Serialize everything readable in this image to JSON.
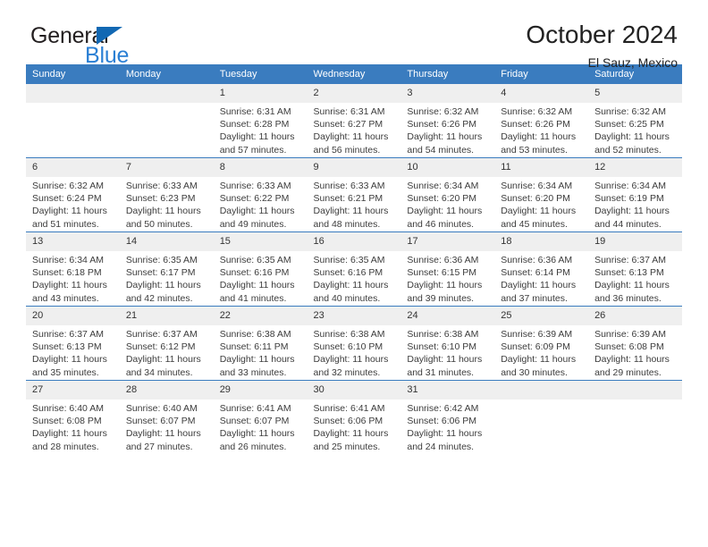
{
  "brand": {
    "name_top": "General",
    "name_bottom": "Blue",
    "triangle_color": "#1268b3",
    "blue_color": "#2a7fd4"
  },
  "header": {
    "title": "October 2024",
    "subtitle": "El Sauz, Mexico"
  },
  "theme": {
    "header_blue": "#3a7cbf",
    "daynum_bg": "#efefef",
    "text": "#3c3c3c"
  },
  "weekday_headers": [
    "Sunday",
    "Monday",
    "Tuesday",
    "Wednesday",
    "Thursday",
    "Friday",
    "Saturday"
  ],
  "labels": {
    "sunrise": "Sunrise:",
    "sunset": "Sunset:",
    "daylight": "Daylight:"
  },
  "weeks": [
    [
      {
        "day": "",
        "blank": true
      },
      {
        "day": "",
        "blank": true
      },
      {
        "day": "1",
        "sunrise": "Sunrise: 6:31 AM",
        "sunset": "Sunset: 6:28 PM",
        "daylight": "Daylight: 11 hours and 57 minutes."
      },
      {
        "day": "2",
        "sunrise": "Sunrise: 6:31 AM",
        "sunset": "Sunset: 6:27 PM",
        "daylight": "Daylight: 11 hours and 56 minutes."
      },
      {
        "day": "3",
        "sunrise": "Sunrise: 6:32 AM",
        "sunset": "Sunset: 6:26 PM",
        "daylight": "Daylight: 11 hours and 54 minutes."
      },
      {
        "day": "4",
        "sunrise": "Sunrise: 6:32 AM",
        "sunset": "Sunset: 6:26 PM",
        "daylight": "Daylight: 11 hours and 53 minutes."
      },
      {
        "day": "5",
        "sunrise": "Sunrise: 6:32 AM",
        "sunset": "Sunset: 6:25 PM",
        "daylight": "Daylight: 11 hours and 52 minutes."
      }
    ],
    [
      {
        "day": "6",
        "sunrise": "Sunrise: 6:32 AM",
        "sunset": "Sunset: 6:24 PM",
        "daylight": "Daylight: 11 hours and 51 minutes."
      },
      {
        "day": "7",
        "sunrise": "Sunrise: 6:33 AM",
        "sunset": "Sunset: 6:23 PM",
        "daylight": "Daylight: 11 hours and 50 minutes."
      },
      {
        "day": "8",
        "sunrise": "Sunrise: 6:33 AM",
        "sunset": "Sunset: 6:22 PM",
        "daylight": "Daylight: 11 hours and 49 minutes."
      },
      {
        "day": "9",
        "sunrise": "Sunrise: 6:33 AM",
        "sunset": "Sunset: 6:21 PM",
        "daylight": "Daylight: 11 hours and 48 minutes."
      },
      {
        "day": "10",
        "sunrise": "Sunrise: 6:34 AM",
        "sunset": "Sunset: 6:20 PM",
        "daylight": "Daylight: 11 hours and 46 minutes."
      },
      {
        "day": "11",
        "sunrise": "Sunrise: 6:34 AM",
        "sunset": "Sunset: 6:20 PM",
        "daylight": "Daylight: 11 hours and 45 minutes."
      },
      {
        "day": "12",
        "sunrise": "Sunrise: 6:34 AM",
        "sunset": "Sunset: 6:19 PM",
        "daylight": "Daylight: 11 hours and 44 minutes."
      }
    ],
    [
      {
        "day": "13",
        "sunrise": "Sunrise: 6:34 AM",
        "sunset": "Sunset: 6:18 PM",
        "daylight": "Daylight: 11 hours and 43 minutes."
      },
      {
        "day": "14",
        "sunrise": "Sunrise: 6:35 AM",
        "sunset": "Sunset: 6:17 PM",
        "daylight": "Daylight: 11 hours and 42 minutes."
      },
      {
        "day": "15",
        "sunrise": "Sunrise: 6:35 AM",
        "sunset": "Sunset: 6:16 PM",
        "daylight": "Daylight: 11 hours and 41 minutes."
      },
      {
        "day": "16",
        "sunrise": "Sunrise: 6:35 AM",
        "sunset": "Sunset: 6:16 PM",
        "daylight": "Daylight: 11 hours and 40 minutes."
      },
      {
        "day": "17",
        "sunrise": "Sunrise: 6:36 AM",
        "sunset": "Sunset: 6:15 PM",
        "daylight": "Daylight: 11 hours and 39 minutes."
      },
      {
        "day": "18",
        "sunrise": "Sunrise: 6:36 AM",
        "sunset": "Sunset: 6:14 PM",
        "daylight": "Daylight: 11 hours and 37 minutes."
      },
      {
        "day": "19",
        "sunrise": "Sunrise: 6:37 AM",
        "sunset": "Sunset: 6:13 PM",
        "daylight": "Daylight: 11 hours and 36 minutes."
      }
    ],
    [
      {
        "day": "20",
        "sunrise": "Sunrise: 6:37 AM",
        "sunset": "Sunset: 6:13 PM",
        "daylight": "Daylight: 11 hours and 35 minutes."
      },
      {
        "day": "21",
        "sunrise": "Sunrise: 6:37 AM",
        "sunset": "Sunset: 6:12 PM",
        "daylight": "Daylight: 11 hours and 34 minutes."
      },
      {
        "day": "22",
        "sunrise": "Sunrise: 6:38 AM",
        "sunset": "Sunset: 6:11 PM",
        "daylight": "Daylight: 11 hours and 33 minutes."
      },
      {
        "day": "23",
        "sunrise": "Sunrise: 6:38 AM",
        "sunset": "Sunset: 6:10 PM",
        "daylight": "Daylight: 11 hours and 32 minutes."
      },
      {
        "day": "24",
        "sunrise": "Sunrise: 6:38 AM",
        "sunset": "Sunset: 6:10 PM",
        "daylight": "Daylight: 11 hours and 31 minutes."
      },
      {
        "day": "25",
        "sunrise": "Sunrise: 6:39 AM",
        "sunset": "Sunset: 6:09 PM",
        "daylight": "Daylight: 11 hours and 30 minutes."
      },
      {
        "day": "26",
        "sunrise": "Sunrise: 6:39 AM",
        "sunset": "Sunset: 6:08 PM",
        "daylight": "Daylight: 11 hours and 29 minutes."
      }
    ],
    [
      {
        "day": "27",
        "sunrise": "Sunrise: 6:40 AM",
        "sunset": "Sunset: 6:08 PM",
        "daylight": "Daylight: 11 hours and 28 minutes."
      },
      {
        "day": "28",
        "sunrise": "Sunrise: 6:40 AM",
        "sunset": "Sunset: 6:07 PM",
        "daylight": "Daylight: 11 hours and 27 minutes."
      },
      {
        "day": "29",
        "sunrise": "Sunrise: 6:41 AM",
        "sunset": "Sunset: 6:07 PM",
        "daylight": "Daylight: 11 hours and 26 minutes."
      },
      {
        "day": "30",
        "sunrise": "Sunrise: 6:41 AM",
        "sunset": "Sunset: 6:06 PM",
        "daylight": "Daylight: 11 hours and 25 minutes."
      },
      {
        "day": "31",
        "sunrise": "Sunrise: 6:42 AM",
        "sunset": "Sunset: 6:06 PM",
        "daylight": "Daylight: 11 hours and 24 minutes."
      },
      {
        "day": "",
        "blank": true
      },
      {
        "day": "",
        "blank": true
      }
    ]
  ]
}
